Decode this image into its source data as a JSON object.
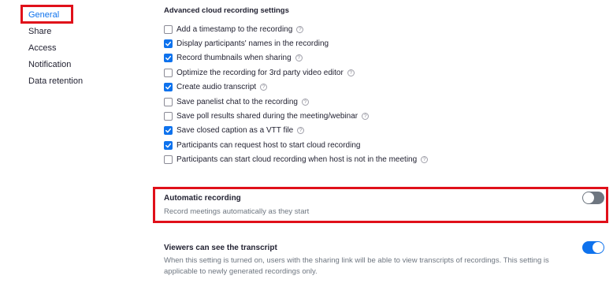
{
  "sidebar": {
    "items": [
      {
        "label": "General",
        "active": true
      },
      {
        "label": "Share"
      },
      {
        "label": "Access"
      },
      {
        "label": "Notification"
      },
      {
        "label": "Data retention"
      }
    ]
  },
  "advanced": {
    "title": "Advanced cloud recording settings",
    "options": [
      {
        "label": "Add a timestamp to the recording",
        "checked": false,
        "help": true
      },
      {
        "label": "Display participants' names in the recording",
        "checked": true,
        "help": false
      },
      {
        "label": "Record thumbnails when sharing",
        "checked": true,
        "help": true
      },
      {
        "label": "Optimize the recording for 3rd party video editor",
        "checked": false,
        "help": true
      },
      {
        "label": "Create audio transcript",
        "checked": true,
        "help": true
      },
      {
        "label": "Save panelist chat to the recording",
        "checked": false,
        "help": true
      },
      {
        "label": "Save poll results shared during the meeting/webinar",
        "checked": false,
        "help": true
      },
      {
        "label": "Save closed caption as a VTT file",
        "checked": true,
        "help": true
      },
      {
        "label": "Participants can request host to start cloud recording",
        "checked": true,
        "help": false
      },
      {
        "label": "Participants can start cloud recording when host is not in the meeting",
        "checked": false,
        "help": true
      }
    ]
  },
  "automatic_recording": {
    "title": "Automatic recording",
    "description": "Record meetings automatically as they start",
    "enabled": false
  },
  "viewers_transcript": {
    "title": "Viewers can see the transcript",
    "description": "When this setting is turned on, users with the sharing link will be able to view transcripts of recordings. This setting is applicable to newly generated recordings only.",
    "enabled": true
  },
  "icons": {
    "help": "question-mark-circle-icon",
    "check": "checkmark-icon"
  },
  "colors": {
    "accent": "#0e72ed",
    "highlight": "#e0101a",
    "toggle_off": "#6e7680"
  }
}
